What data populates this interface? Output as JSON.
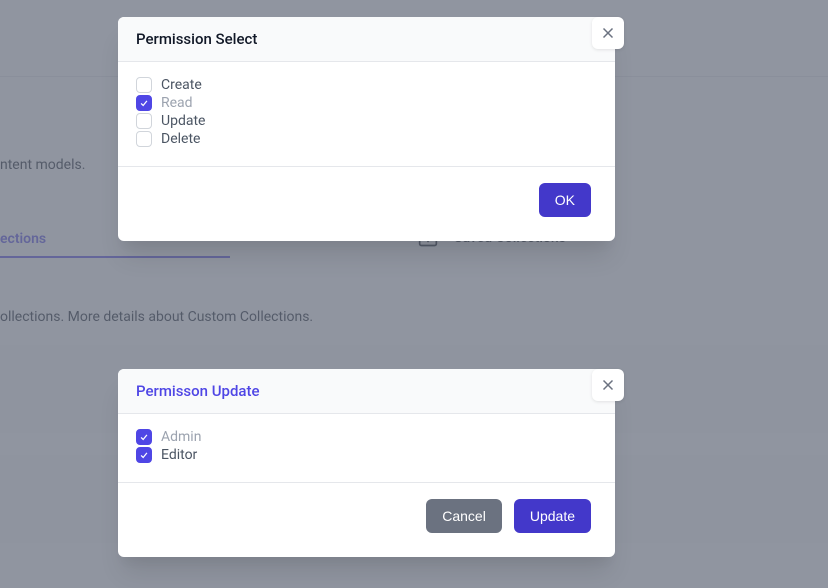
{
  "background": {
    "text_fragment_1": "ntent models.",
    "tab_active_label": "ections",
    "tab_saved_label": "Saved Collections",
    "tab_saved_icon": "folder-plus-icon",
    "text_fragment_2": "ollections. More details about Custom Collections."
  },
  "modal1": {
    "title": "Permission Select",
    "options": [
      {
        "label": "Create",
        "checked": false
      },
      {
        "label": "Read",
        "checked": true
      },
      {
        "label": "Update",
        "checked": false
      },
      {
        "label": "Delete",
        "checked": false
      }
    ],
    "ok_label": "OK"
  },
  "modal2": {
    "title": "Permisson Update",
    "options": [
      {
        "label": "Admin",
        "checked": true
      },
      {
        "label": "Editor",
        "checked": true
      }
    ],
    "cancel_label": "Cancel",
    "update_label": "Update"
  }
}
